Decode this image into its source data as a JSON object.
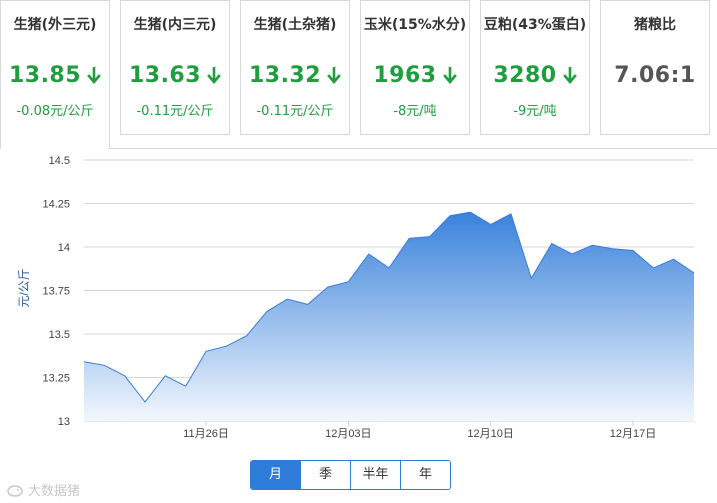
{
  "tabs": [
    {
      "name": "生猪(外三元)",
      "price": "13.85",
      "change": "-0.08元/公斤",
      "trend": "down"
    },
    {
      "name": "生猪(内三元)",
      "price": "13.63",
      "change": "-0.11元/公斤",
      "trend": "down"
    },
    {
      "name": "生猪(土杂猪)",
      "price": "13.32",
      "change": "-0.11元/公斤",
      "trend": "down"
    },
    {
      "name": "玉米(15%水分)",
      "price": "1963",
      "change": "-8元/吨",
      "trend": "down"
    },
    {
      "name": "豆粕(43%蛋白)",
      "price": "3280",
      "change": "-9元/吨",
      "trend": "down"
    },
    {
      "name": "猪粮比",
      "price": "7.06:1",
      "change": "",
      "trend": "none"
    }
  ],
  "colors": {
    "down": "#1f9e3f",
    "accent": "#2e7cd9",
    "fill_top": "#3a82dc",
    "fill_bottom": "#f2f7fd"
  },
  "period_buttons": [
    {
      "label": "月",
      "active": true
    },
    {
      "label": "季",
      "active": false
    },
    {
      "label": "半年",
      "active": false
    },
    {
      "label": "年",
      "active": false
    }
  ],
  "watermark": "大数据猪",
  "chart_data": {
    "type": "area",
    "ylabel": "元/公斤",
    "ylim": [
      13,
      14.5
    ],
    "yticks": [
      13,
      13.25,
      13.5,
      13.75,
      14,
      14.25,
      14.5
    ],
    "ytick_labels": [
      "13",
      "13.25",
      "13.5",
      "13.75",
      "14",
      "14.25",
      "14.5"
    ],
    "grid": true,
    "x": [
      "11-19",
      "11-20",
      "11-21",
      "11-22",
      "11-23",
      "11-24",
      "11-25",
      "11-26",
      "11-27",
      "11-28",
      "11-29",
      "11-30",
      "12-01",
      "12-02",
      "12-03",
      "12-04",
      "12-05",
      "12-06",
      "12-07",
      "12-08",
      "12-09",
      "12-10",
      "12-11",
      "12-12",
      "12-13",
      "12-14",
      "12-15",
      "12-16",
      "12-17",
      "12-18",
      "12-19"
    ],
    "xtick_labels": [
      {
        "index": 6,
        "label": "11月26日"
      },
      {
        "index": 13,
        "label": "12月03日"
      },
      {
        "index": 20,
        "label": "12月10日"
      },
      {
        "index": 27,
        "label": "12月17日"
      }
    ],
    "series": [
      {
        "values": [
          13.34,
          13.32,
          13.26,
          13.11,
          13.26,
          13.2,
          13.4,
          13.43,
          13.49,
          13.63,
          13.7,
          13.67,
          13.77,
          13.8,
          13.96,
          13.88,
          14.05,
          14.06,
          14.18,
          14.2,
          14.13,
          14.19,
          13.82,
          14.02,
          13.96,
          14.01,
          13.99,
          13.98,
          13.88,
          13.93,
          13.85
        ]
      }
    ]
  }
}
